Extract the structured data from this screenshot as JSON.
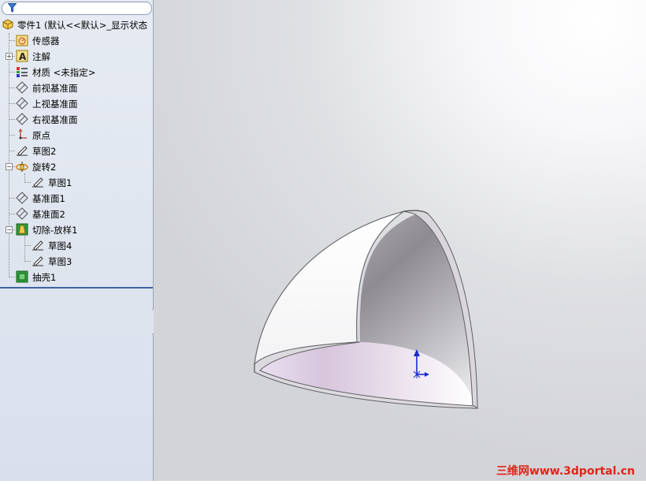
{
  "feature_tree": {
    "root_label": "零件1 (默认<<默认>_显示状态",
    "items": [
      {
        "label": "传感器"
      },
      {
        "label": "注解"
      },
      {
        "label": "材质 <未指定>"
      },
      {
        "label": "前视基准面"
      },
      {
        "label": "上视基准面"
      },
      {
        "label": "右视基准面"
      },
      {
        "label": "原点"
      },
      {
        "label": "草图2"
      },
      {
        "label": "旋转2"
      },
      {
        "label": "草图1"
      },
      {
        "label": "基准面1"
      },
      {
        "label": "基准面2"
      },
      {
        "label": "切除-放样1"
      },
      {
        "label": "草图4"
      },
      {
        "label": "草图3"
      },
      {
        "label": "抽壳1"
      }
    ]
  },
  "watermark": "三维网www.3dportal.cn",
  "colors": {
    "watermark": "#e2231a",
    "triad_axis": "#1a2ccc",
    "tree_separator": "#3c64a0"
  }
}
